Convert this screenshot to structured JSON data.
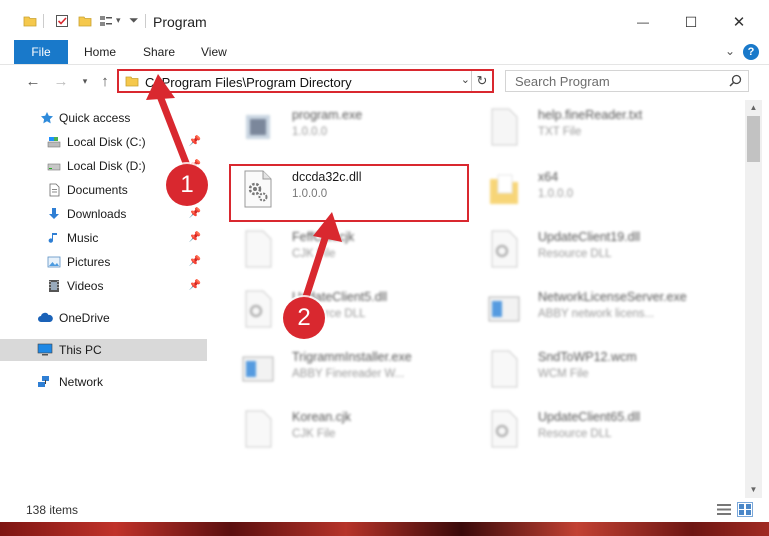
{
  "window": {
    "title": "Program",
    "minimize": "—",
    "maximize": "☐",
    "close": "✕"
  },
  "ribbon": {
    "file_label": "File",
    "tabs": [
      {
        "label": "Home"
      },
      {
        "label": "Share"
      },
      {
        "label": "View"
      }
    ],
    "help": "?"
  },
  "address": {
    "path": "C:\\Program Files\\Program Directory",
    "search_placeholder": "Search Program"
  },
  "nav": {
    "quick_access": "Quick access",
    "items": [
      {
        "label": "Local Disk (C:)",
        "icon": "drive-icon",
        "pinned": true
      },
      {
        "label": "Local Disk (D:)",
        "icon": "drive-icon",
        "pinned": true
      },
      {
        "label": "Documents",
        "icon": "documents-icon",
        "pinned": true
      },
      {
        "label": "Downloads",
        "icon": "downloads-icon",
        "pinned": true
      },
      {
        "label": "Music",
        "icon": "music-icon",
        "pinned": true
      },
      {
        "label": "Pictures",
        "icon": "pictures-icon",
        "pinned": true
      },
      {
        "label": "Videos",
        "icon": "videos-icon",
        "pinned": true
      }
    ],
    "onedrive": "OneDrive",
    "this_pc": "This PC",
    "network": "Network"
  },
  "files": [
    {
      "name": "program.exe",
      "sub": "1.0.0.0",
      "icon": "exe-icon"
    },
    {
      "name": "help.fineReader.txt",
      "sub": "TXT File",
      "icon": "txt-file-icon"
    },
    {
      "name": "dccda32c.dll",
      "sub": "1.0.0.0",
      "icon": "dll-gear-icon"
    },
    {
      "name": "x64",
      "sub": "1.0.0.0",
      "icon": "folder-icon"
    },
    {
      "name": "FeffChk.cjk",
      "sub": "CJK File",
      "icon": "blank-file-icon"
    },
    {
      "name": "UpdateClient19.dll",
      "sub": "Resource DLL",
      "icon": "dll-gear-icon"
    },
    {
      "name": "UpdateClient5.dll",
      "sub": "Resource DLL",
      "icon": "dll-gear-icon"
    },
    {
      "name": "NetworkLicenseServer.exe",
      "sub": "ABBY network licens...",
      "icon": "exe-window-icon"
    },
    {
      "name": "TrigrammInstaller.exe",
      "sub": "ABBY Finereader W...",
      "icon": "exe-window-icon"
    },
    {
      "name": "SndToWP12.wcm",
      "sub": "WCM File",
      "icon": "blank-file-icon"
    },
    {
      "name": "Korean.cjk",
      "sub": "CJK File",
      "icon": "blank-file-icon"
    },
    {
      "name": "UpdateClient65.dll",
      "sub": "Resource DLL",
      "icon": "dll-gear-icon"
    }
  ],
  "status": {
    "item_count": "138 items"
  },
  "callouts": {
    "one": "1",
    "two": "2"
  },
  "colors": {
    "accent": "#1979ca",
    "highlight": "#d9282f",
    "selected": "#d9d9d9"
  }
}
